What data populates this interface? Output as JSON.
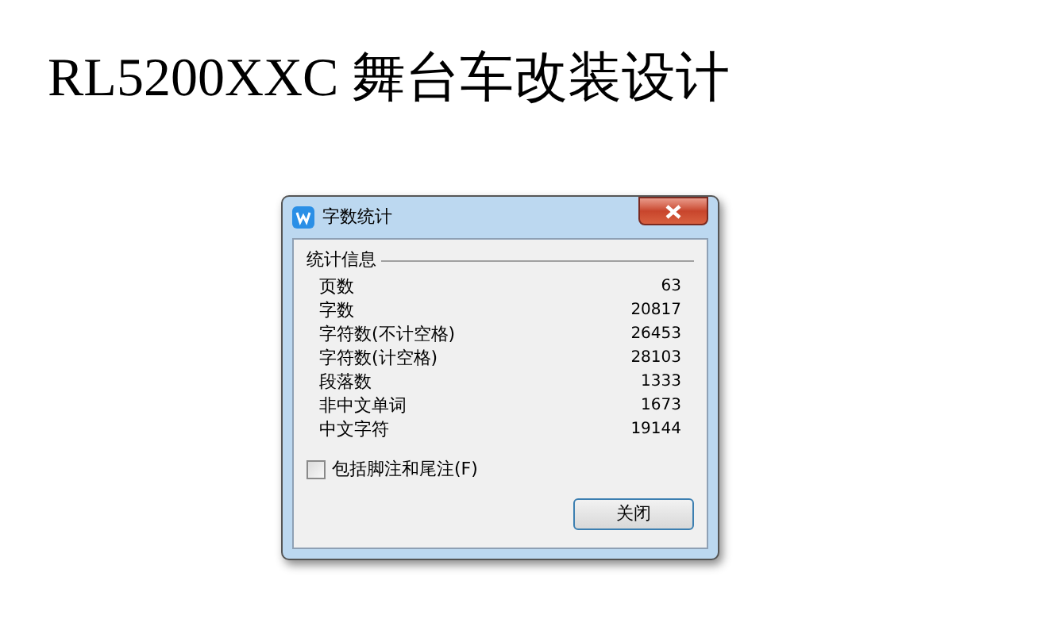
{
  "slide_title": "RL5200XXC 舞台车改装设计",
  "dialog": {
    "title": "字数统计",
    "group_label": "统计信息",
    "stats": [
      {
        "label": "页数",
        "value": "63"
      },
      {
        "label": "字数",
        "value": "20817"
      },
      {
        "label": "字符数(不计空格)",
        "value": "26453"
      },
      {
        "label": "字符数(计空格)",
        "value": "28103"
      },
      {
        "label": "段落数",
        "value": "1333"
      },
      {
        "label": "非中文单词",
        "value": "1673"
      },
      {
        "label": "中文字符",
        "value": "19144"
      }
    ],
    "checkbox": {
      "label": "包括脚注和尾注(F)",
      "checked": false
    },
    "close_button": "关闭"
  }
}
